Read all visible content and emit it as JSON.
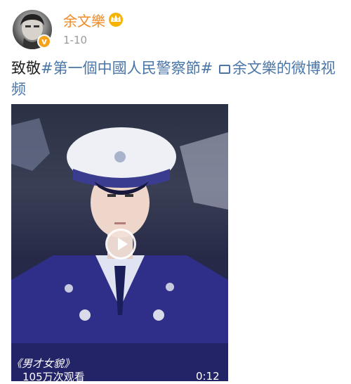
{
  "post": {
    "author": "余文樂",
    "verified_badge": "v",
    "time": "1-10",
    "text_prefix": "致敬",
    "hashtag": "#第一個中國人民警察節#",
    "link_text": "余文樂的微博视频",
    "colors": {
      "author": "#f08a24",
      "hashtag": "#4a76a8",
      "badge": "#f7a21b"
    }
  },
  "video": {
    "overlay_title": "《男才女貌》",
    "views": "105万次观看",
    "duration": "0:12"
  },
  "icons": [
    "avatar",
    "verified-badge-icon",
    "crown-icon",
    "link-icon",
    "play-icon"
  ]
}
